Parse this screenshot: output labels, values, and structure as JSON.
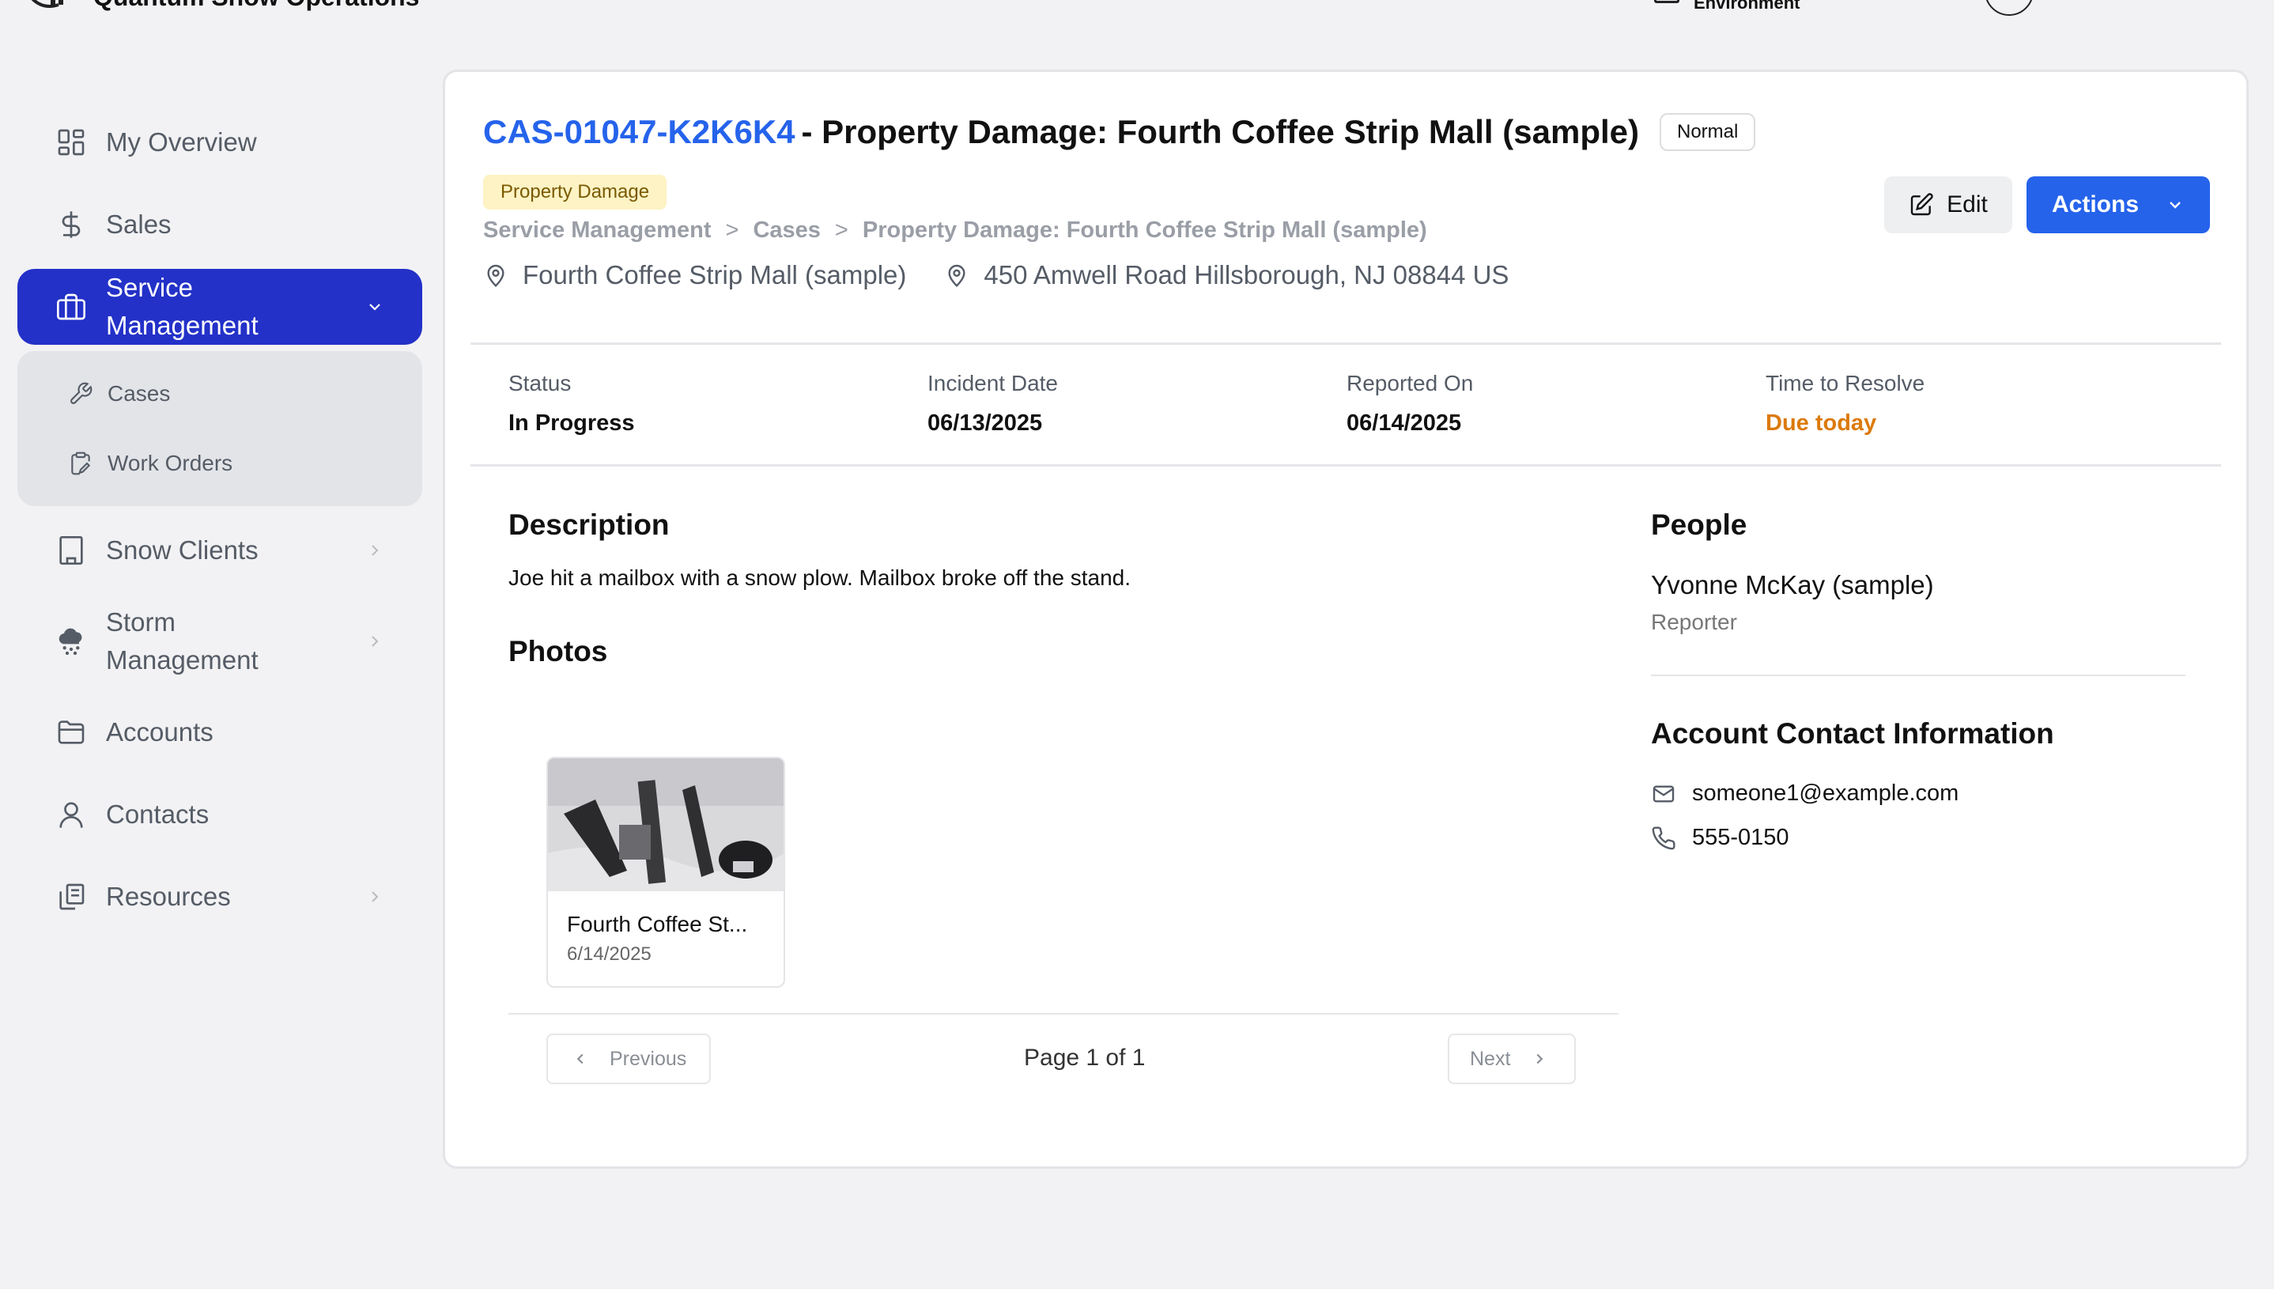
{
  "header": {
    "app_title": "Quantum Snow Operations",
    "environment_label": "Environment"
  },
  "sidebar": {
    "items": [
      {
        "label": "My Overview",
        "icon": "dashboard-icon"
      },
      {
        "label": "Sales",
        "icon": "dollar-icon"
      },
      {
        "label": "Service Management",
        "icon": "briefcase-icon",
        "expanded": true,
        "children": [
          {
            "label": "Cases",
            "icon": "wrench-icon"
          },
          {
            "label": "Work Orders",
            "icon": "clipboard-edit-icon"
          }
        ]
      },
      {
        "label": "Snow Clients",
        "icon": "building-icon"
      },
      {
        "label": "Storm Management",
        "icon": "snow-cloud-icon"
      },
      {
        "label": "Accounts",
        "icon": "folder-icon"
      },
      {
        "label": "Contacts",
        "icon": "user-icon"
      },
      {
        "label": "Resources",
        "icon": "copy-icon"
      }
    ],
    "active_color": "#2331c8"
  },
  "case": {
    "id": "CAS-01047-K2K6K4",
    "title": "- Property Damage: Fourth Coffee Strip Mall (sample)",
    "priority": "Normal",
    "type": "Property Damage",
    "breadcrumb": [
      "Service Management",
      "Cases",
      "Property Damage: Fourth Coffee Strip Mall (sample)"
    ],
    "breadcrumb_separator": ">",
    "location_name": "Fourth Coffee Strip Mall (sample)",
    "address": "450 Amwell Road Hillsborough, NJ 08844 US"
  },
  "toolbar": {
    "edit_label": "Edit",
    "actions_label": "Actions"
  },
  "stats": [
    {
      "label": "Status",
      "value": "In Progress"
    },
    {
      "label": "Incident Date",
      "value": "06/13/2025"
    },
    {
      "label": "Reported On",
      "value": "06/14/2025"
    },
    {
      "label": "Time to Resolve",
      "value": "Due today",
      "color": "#dc7a0b"
    }
  ],
  "description": {
    "heading": "Description",
    "text": "Joe hit a mailbox with a snow plow. Mailbox broke off the stand."
  },
  "photos": {
    "heading": "Photos",
    "items": [
      {
        "name": "Fourth Coffee St...",
        "date": "6/14/2025"
      }
    ],
    "pager": {
      "previous_label": "Previous",
      "next_label": "Next",
      "page_text": "Page 1 of 1"
    }
  },
  "people": {
    "heading": "People",
    "name": "Yvonne McKay (sample)",
    "role": "Reporter"
  },
  "contact": {
    "heading": "Account Contact Information",
    "email": "someone1@example.com",
    "phone": "555-0150"
  },
  "colors": {
    "link_blue": "#2563eb",
    "badge_yellow_bg": "#fdf3c4",
    "due_orange": "#dc7a0b"
  }
}
